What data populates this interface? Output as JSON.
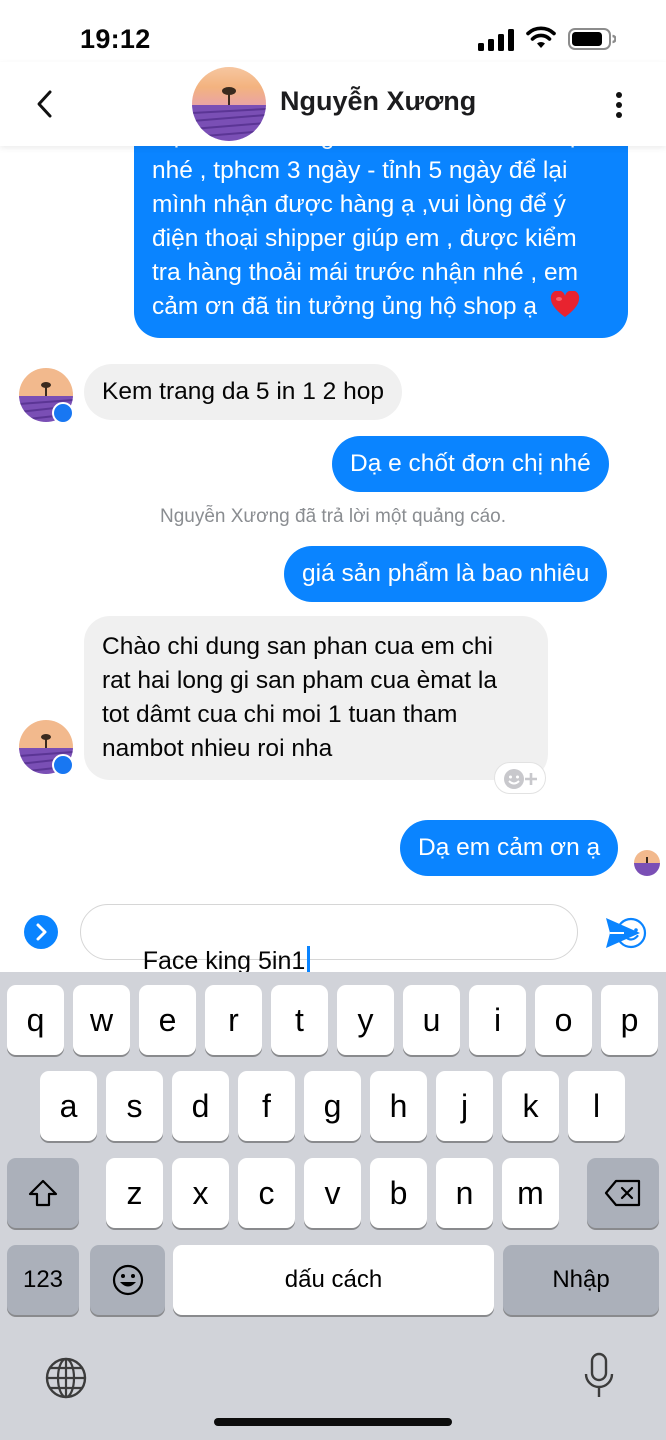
{
  "status": {
    "time": "19:12"
  },
  "header": {
    "contact_name": "Nguyễn Xương"
  },
  "messages": {
    "out1_lines": [
      "Dạ em lên đơn giao cho mình anh - chị",
      "nhé , tphcm 3 ngày - tỉnh 5 ngày để lại",
      "mình nhận được hàng ạ ,vui lòng để ý",
      "điện thoại shipper giúp em , được kiểm",
      "tra hàng thoải mái trước nhận nhé , em",
      "cảm ơn đã tin tưởng ủng hộ shop ạ"
    ],
    "in1": "Kem trang da 5 in 1 2 hop",
    "out2": "Dạ e chốt đơn chị nhé",
    "ad_reply_notice": "Nguyễn Xương đã trả lời một quảng cáo.",
    "out3": "giá sản phẩm là bao nhiêu",
    "in2_lines": [
      "Chào chi dung san phan cua em  chi",
      "rat hai long gi san pham cua èmat la",
      "tot dâmt cua chi moi 1 tuan tham",
      "nambot nhieu roi nha"
    ],
    "out4": "Dạ em cảm ơn ạ"
  },
  "composer": {
    "text": "Face king 5in1"
  },
  "keyboard": {
    "row1": [
      "q",
      "w",
      "e",
      "r",
      "t",
      "y",
      "u",
      "i",
      "o",
      "p"
    ],
    "row2": [
      "a",
      "s",
      "d",
      "f",
      "g",
      "h",
      "j",
      "k",
      "l"
    ],
    "row3": [
      "z",
      "x",
      "c",
      "v",
      "b",
      "n",
      "m"
    ],
    "numbers_key": "123",
    "space_key": "dấu cách",
    "return_key": "Nhập"
  },
  "colors": {
    "outgoing_bubble": "#0a84ff",
    "incoming_bubble": "#f0f0f0",
    "keyboard_bg": "#d1d3d9"
  },
  "icons": [
    "back-icon",
    "more-icon",
    "messenger-badge-icon",
    "heart-emoji-icon",
    "add-reaction-icon",
    "expand-icon",
    "emoji-icon",
    "send-icon",
    "shift-icon",
    "backspace-icon",
    "emoji-keyboard-icon",
    "globe-icon",
    "microphone-icon"
  ]
}
